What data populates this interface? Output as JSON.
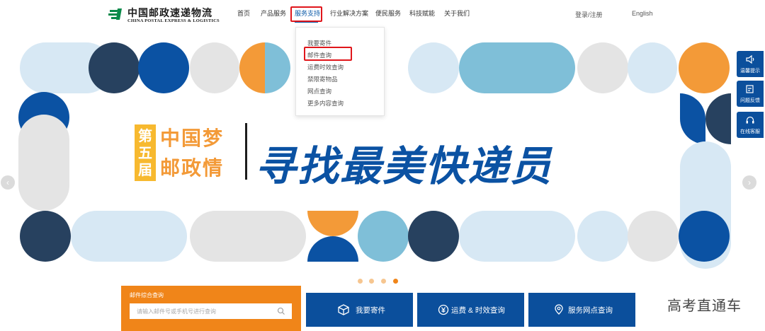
{
  "header": {
    "logo_cn": "中国邮政速递物流",
    "logo_en": "CHINA POSTAL EXPRESS & LOGISTICS",
    "nav": [
      {
        "label": "首页"
      },
      {
        "label": "产品服务"
      },
      {
        "label": "服务支持"
      },
      {
        "label": "行业解决方案"
      },
      {
        "label": "便民服务"
      },
      {
        "label": "科技赋能"
      },
      {
        "label": "关于我们"
      }
    ],
    "active_nav": "服务支持",
    "login": "登录/注册",
    "lang": "English"
  },
  "dropdown": {
    "items": [
      {
        "label": "我要寄件"
      },
      {
        "label": "邮件查询"
      },
      {
        "label": "运费时效查询"
      },
      {
        "label": "禁限寄物品"
      },
      {
        "label": "网点查询"
      },
      {
        "label": "更多内容查询"
      }
    ],
    "highlighted": "邮件查询"
  },
  "banner": {
    "badge": "第五届",
    "slogan_top": "中国梦",
    "slogan_bottom": "邮政情",
    "headline": "寻找最美快递员",
    "active_slide": 4,
    "slide_count": 4
  },
  "float_tools": [
    {
      "label": "温馨提示",
      "icon": "speaker-icon"
    },
    {
      "label": "问题反馈",
      "icon": "edit-icon"
    },
    {
      "label": "在线客服",
      "icon": "headset-icon"
    }
  ],
  "query": {
    "title": "邮件综合查询",
    "placeholder": "请输入邮件号或手机号进行查询"
  },
  "services": [
    {
      "label": "我要寄件",
      "icon": "box-icon"
    },
    {
      "label": "运费 & 时效查询",
      "icon": "yuan-icon"
    },
    {
      "label": "服务网点查询",
      "icon": "location-icon"
    }
  ],
  "watermark": "高考直通车",
  "colors": {
    "brand_blue": "#0b4f9c",
    "accent_orange": "#f08519",
    "highlight_red": "#e0161b",
    "logo_green": "#0a8a4a",
    "navy": "#27415f",
    "sky": "#7fbfd8",
    "pale_blue": "#d7e8f4",
    "badge_yellow": "#f7b92f"
  }
}
